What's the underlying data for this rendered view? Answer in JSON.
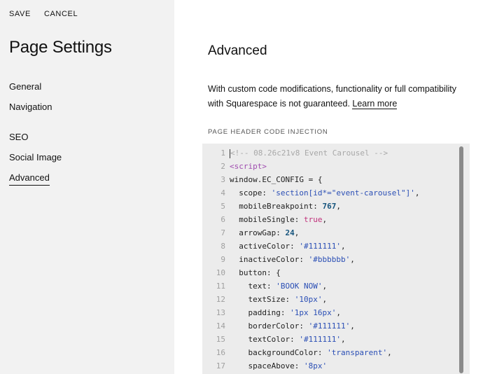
{
  "topbar": {
    "save_label": "SAVE",
    "cancel_label": "CANCEL"
  },
  "sidebar": {
    "title": "Page Settings",
    "items": [
      {
        "label": "General"
      },
      {
        "label": "Navigation"
      },
      {
        "label": "SEO"
      },
      {
        "label": "Social Image"
      },
      {
        "label": "Advanced",
        "active": true
      }
    ]
  },
  "main": {
    "heading": "Advanced",
    "description": "With custom code modifications, functionality or full compatibility with Squarespace is not guaranteed.",
    "learn_more": "Learn more",
    "section_label": "PAGE HEADER CODE INJECTION"
  },
  "editor": {
    "lines": [
      {
        "n": "1",
        "tokens": [
          [
            "comment",
            "<!-- 08.26c21v8 Event Carousel -->"
          ]
        ]
      },
      {
        "n": "2",
        "tokens": [
          [
            "tag",
            "<script>"
          ]
        ]
      },
      {
        "n": "3",
        "tokens": [
          [
            "plain",
            "window.EC_CONFIG = {"
          ]
        ]
      },
      {
        "n": "4",
        "tokens": [
          [
            "plain",
            "  scope: "
          ],
          [
            "string",
            "'section[id*=\"event-carousel\"]'"
          ],
          [
            "plain",
            ","
          ]
        ]
      },
      {
        "n": "5",
        "tokens": [
          [
            "plain",
            "  mobileBreakpoint: "
          ],
          [
            "number",
            "767"
          ],
          [
            "plain",
            ","
          ]
        ]
      },
      {
        "n": "6",
        "tokens": [
          [
            "plain",
            "  mobileSingle: "
          ],
          [
            "bool",
            "true"
          ],
          [
            "plain",
            ","
          ]
        ]
      },
      {
        "n": "7",
        "tokens": [
          [
            "plain",
            "  arrowGap: "
          ],
          [
            "number",
            "24"
          ],
          [
            "plain",
            ","
          ]
        ]
      },
      {
        "n": "8",
        "tokens": [
          [
            "plain",
            "  activeColor: "
          ],
          [
            "string",
            "'#111111'"
          ],
          [
            "plain",
            ","
          ]
        ]
      },
      {
        "n": "9",
        "tokens": [
          [
            "plain",
            "  inactiveColor: "
          ],
          [
            "string",
            "'#bbbbbb'"
          ],
          [
            "plain",
            ","
          ]
        ]
      },
      {
        "n": "10",
        "tokens": [
          [
            "plain",
            "  button: {"
          ]
        ]
      },
      {
        "n": "11",
        "tokens": [
          [
            "plain",
            "    text: "
          ],
          [
            "string",
            "'BOOK NOW'"
          ],
          [
            "plain",
            ","
          ]
        ]
      },
      {
        "n": "12",
        "tokens": [
          [
            "plain",
            "    textSize: "
          ],
          [
            "string",
            "'10px'"
          ],
          [
            "plain",
            ","
          ]
        ]
      },
      {
        "n": "13",
        "tokens": [
          [
            "plain",
            "    padding: "
          ],
          [
            "string",
            "'1px 16px'"
          ],
          [
            "plain",
            ","
          ]
        ]
      },
      {
        "n": "14",
        "tokens": [
          [
            "plain",
            "    borderColor: "
          ],
          [
            "string",
            "'#111111'"
          ],
          [
            "plain",
            ","
          ]
        ]
      },
      {
        "n": "15",
        "tokens": [
          [
            "plain",
            "    textColor: "
          ],
          [
            "string",
            "'#111111'"
          ],
          [
            "plain",
            ","
          ]
        ]
      },
      {
        "n": "16",
        "tokens": [
          [
            "plain",
            "    backgroundColor: "
          ],
          [
            "string",
            "'transparent'"
          ],
          [
            "plain",
            ","
          ]
        ]
      },
      {
        "n": "17",
        "tokens": [
          [
            "plain",
            "    spaceAbove: "
          ],
          [
            "string",
            "'8px'"
          ]
        ]
      }
    ]
  },
  "colors": {
    "sidebar_bg": "#f2f2f2",
    "editor_bg": "#ececec",
    "string": "#2b4fb5",
    "number": "#17557e",
    "tag": "#a04db0",
    "bool": "#c0307a",
    "comment": "#a8a8a8"
  }
}
